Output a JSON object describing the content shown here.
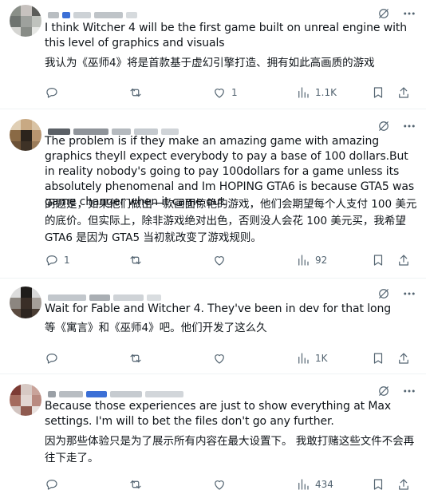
{
  "posts": [
    {
      "text_en": "I think Witcher 4 will be the first game built on unreal engine with this level of graphics and visuals",
      "text_zh": "我认为《巫师4》将是首款基于虚幻引擎打造、拥有如此高画质的游戏",
      "replies": "",
      "reposts": "",
      "likes": "1",
      "views": "1.1K"
    },
    {
      "text_en": "The problem is if they make an amazing game with amazing graphics theyll expect everybody to pay a base of 100 dollars.But in reality nobody's going to pay 100dollars for a game unless its absolutely phenomenal and Im HOPING GTA6 is because GTA5 was game changer when it came out.",
      "text_zh": "问题是，如果他们做出一款画面惊艳的游戏，他们会期望每个人支付 100 美元的底价。但实际上，除非游戏绝对出色，否则没人会花 100 美元买，我希望 GTA6 是因为 GTA5 当初就改变了游戏规则。",
      "replies": "1",
      "reposts": "",
      "likes": "",
      "views": "92"
    },
    {
      "text_en": "Wait for Fable and Witcher 4. They've been in dev for that long",
      "text_zh": "等《寓言》和《巫师4》吧。他们开发了这么久",
      "replies": "",
      "reposts": "",
      "likes": "",
      "views": "1K"
    },
    {
      "text_en": "Because those experiences are just to show everything at Max settings. I'm will to bet the files don't go any further.",
      "text_zh": "因为那些体验只是为了展示所有内容在最大设置下。 我敢打赌这些文件不会再往下走了。",
      "replies": "",
      "reposts": "",
      "likes": "",
      "views": "434"
    }
  ],
  "icons": {
    "grok": "grok-icon",
    "more": "more-icon",
    "reply": "reply-icon",
    "repost": "repost-icon",
    "like": "like-icon",
    "views": "views-icon",
    "bookmark": "bookmark-icon",
    "share": "share-icon"
  }
}
